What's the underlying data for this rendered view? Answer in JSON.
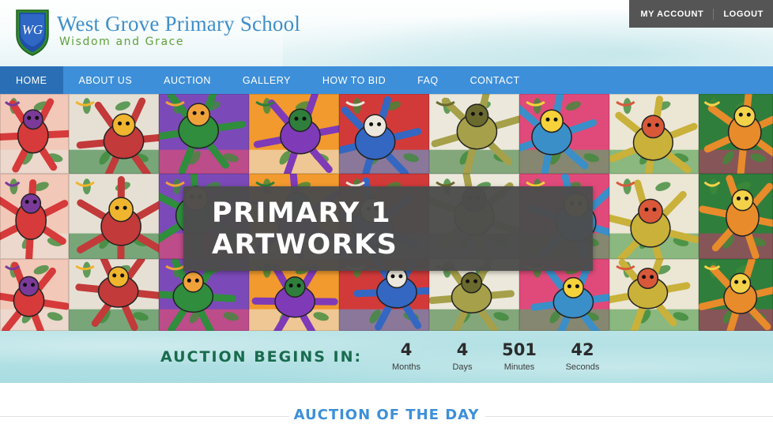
{
  "header": {
    "school_name": "West Grove Primary School",
    "motto": "Wisdom and Grace",
    "logo_icon": "school-crest-icon",
    "logo_monogram": "WG",
    "colors": {
      "name": "#3f8fc9",
      "motto": "#5fa23a"
    }
  },
  "account": {
    "my_account": "MY ACCOUNT",
    "logout": "LOGOUT"
  },
  "nav": {
    "items": [
      {
        "label": "HOME",
        "active": true
      },
      {
        "label": "ABOUT US",
        "active": false
      },
      {
        "label": "AUCTION",
        "active": false
      },
      {
        "label": "GALLERY",
        "active": false
      },
      {
        "label": "HOW TO BID",
        "active": false
      },
      {
        "label": "FAQ",
        "active": false
      },
      {
        "label": "CONTACT",
        "active": false
      }
    ],
    "colors": {
      "bar": "#3d8fd9",
      "active": "#2a6fb6"
    }
  },
  "hero": {
    "title_line1": "PRIMARY 1",
    "title_line2": "ARTWORKS"
  },
  "countdown": {
    "label": "AUCTION BEGINS IN:",
    "units": [
      {
        "value": "4",
        "name": "Months"
      },
      {
        "value": "4",
        "name": "Days"
      },
      {
        "value": "501",
        "name": "Minutes"
      },
      {
        "value": "42",
        "name": "Seconds"
      }
    ]
  },
  "section": {
    "title": "AUCTION OF THE DAY"
  }
}
